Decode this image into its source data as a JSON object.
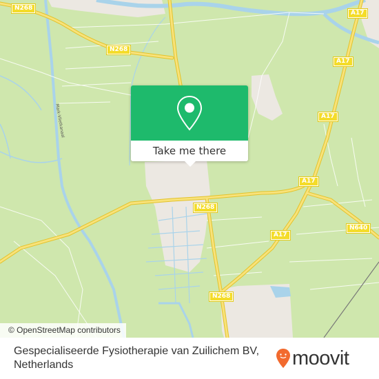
{
  "map": {
    "colors": {
      "land": "#cfe7ad",
      "water": "#a9d3ea",
      "urban": "#ece8e2",
      "road_major": "#f6d94c",
      "road_minor": "#ffffff",
      "popup_green": "#1eba6c",
      "brand_orange": "#f26a2e"
    },
    "road_shields": [
      {
        "id": "n268-top-left",
        "label": "N268"
      },
      {
        "id": "n268-upper",
        "label": "N268"
      },
      {
        "id": "a17-top",
        "label": "A17"
      },
      {
        "id": "a17-upper",
        "label": "A17"
      },
      {
        "id": "a17-middle",
        "label": "A17"
      },
      {
        "id": "a17-junction",
        "label": "A17"
      },
      {
        "id": "n268-middle",
        "label": "N268"
      },
      {
        "id": "a17-lower",
        "label": "A17"
      },
      {
        "id": "n640",
        "label": "N640"
      },
      {
        "id": "n268-bottom",
        "label": "N268"
      }
    ],
    "waterway_label": "Mark-Vlietkanaal",
    "attribution": "© OpenStreetMap contributors"
  },
  "popup": {
    "icon": "map-pin-icon",
    "button_label": "Take me there"
  },
  "footer": {
    "place_name_line1": "Gespecialiseerde Fysiotherapie van Zuilichem BV,",
    "place_name_line2": "Netherlands",
    "logo_icon": "moovit-pin-icon",
    "logo_text": "moovit"
  }
}
